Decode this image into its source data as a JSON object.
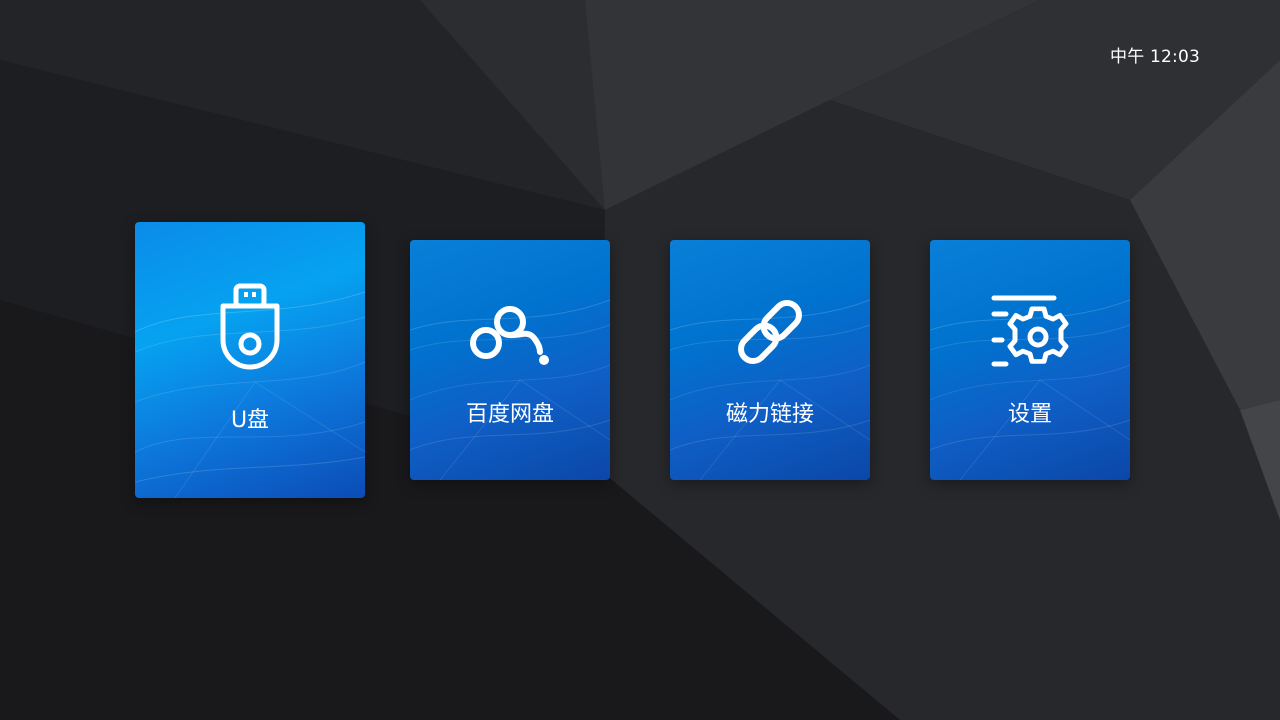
{
  "status_bar": {
    "clock": "中午 12:03"
  },
  "tiles": [
    {
      "id": "usb",
      "label": "U盘",
      "icon": "usb-drive-icon",
      "focused": true
    },
    {
      "id": "baidu",
      "label": "百度网盘",
      "icon": "baidu-cloud-icon",
      "focused": false
    },
    {
      "id": "magnet",
      "label": "磁力链接",
      "icon": "link-icon",
      "focused": false
    },
    {
      "id": "settings",
      "label": "设置",
      "icon": "settings-gear-icon",
      "focused": false
    }
  ],
  "colors": {
    "background": "#1f2023",
    "tile_blue": "#0073cf",
    "tile_focused_blue": "#06a2f0",
    "text": "#ffffff"
  }
}
